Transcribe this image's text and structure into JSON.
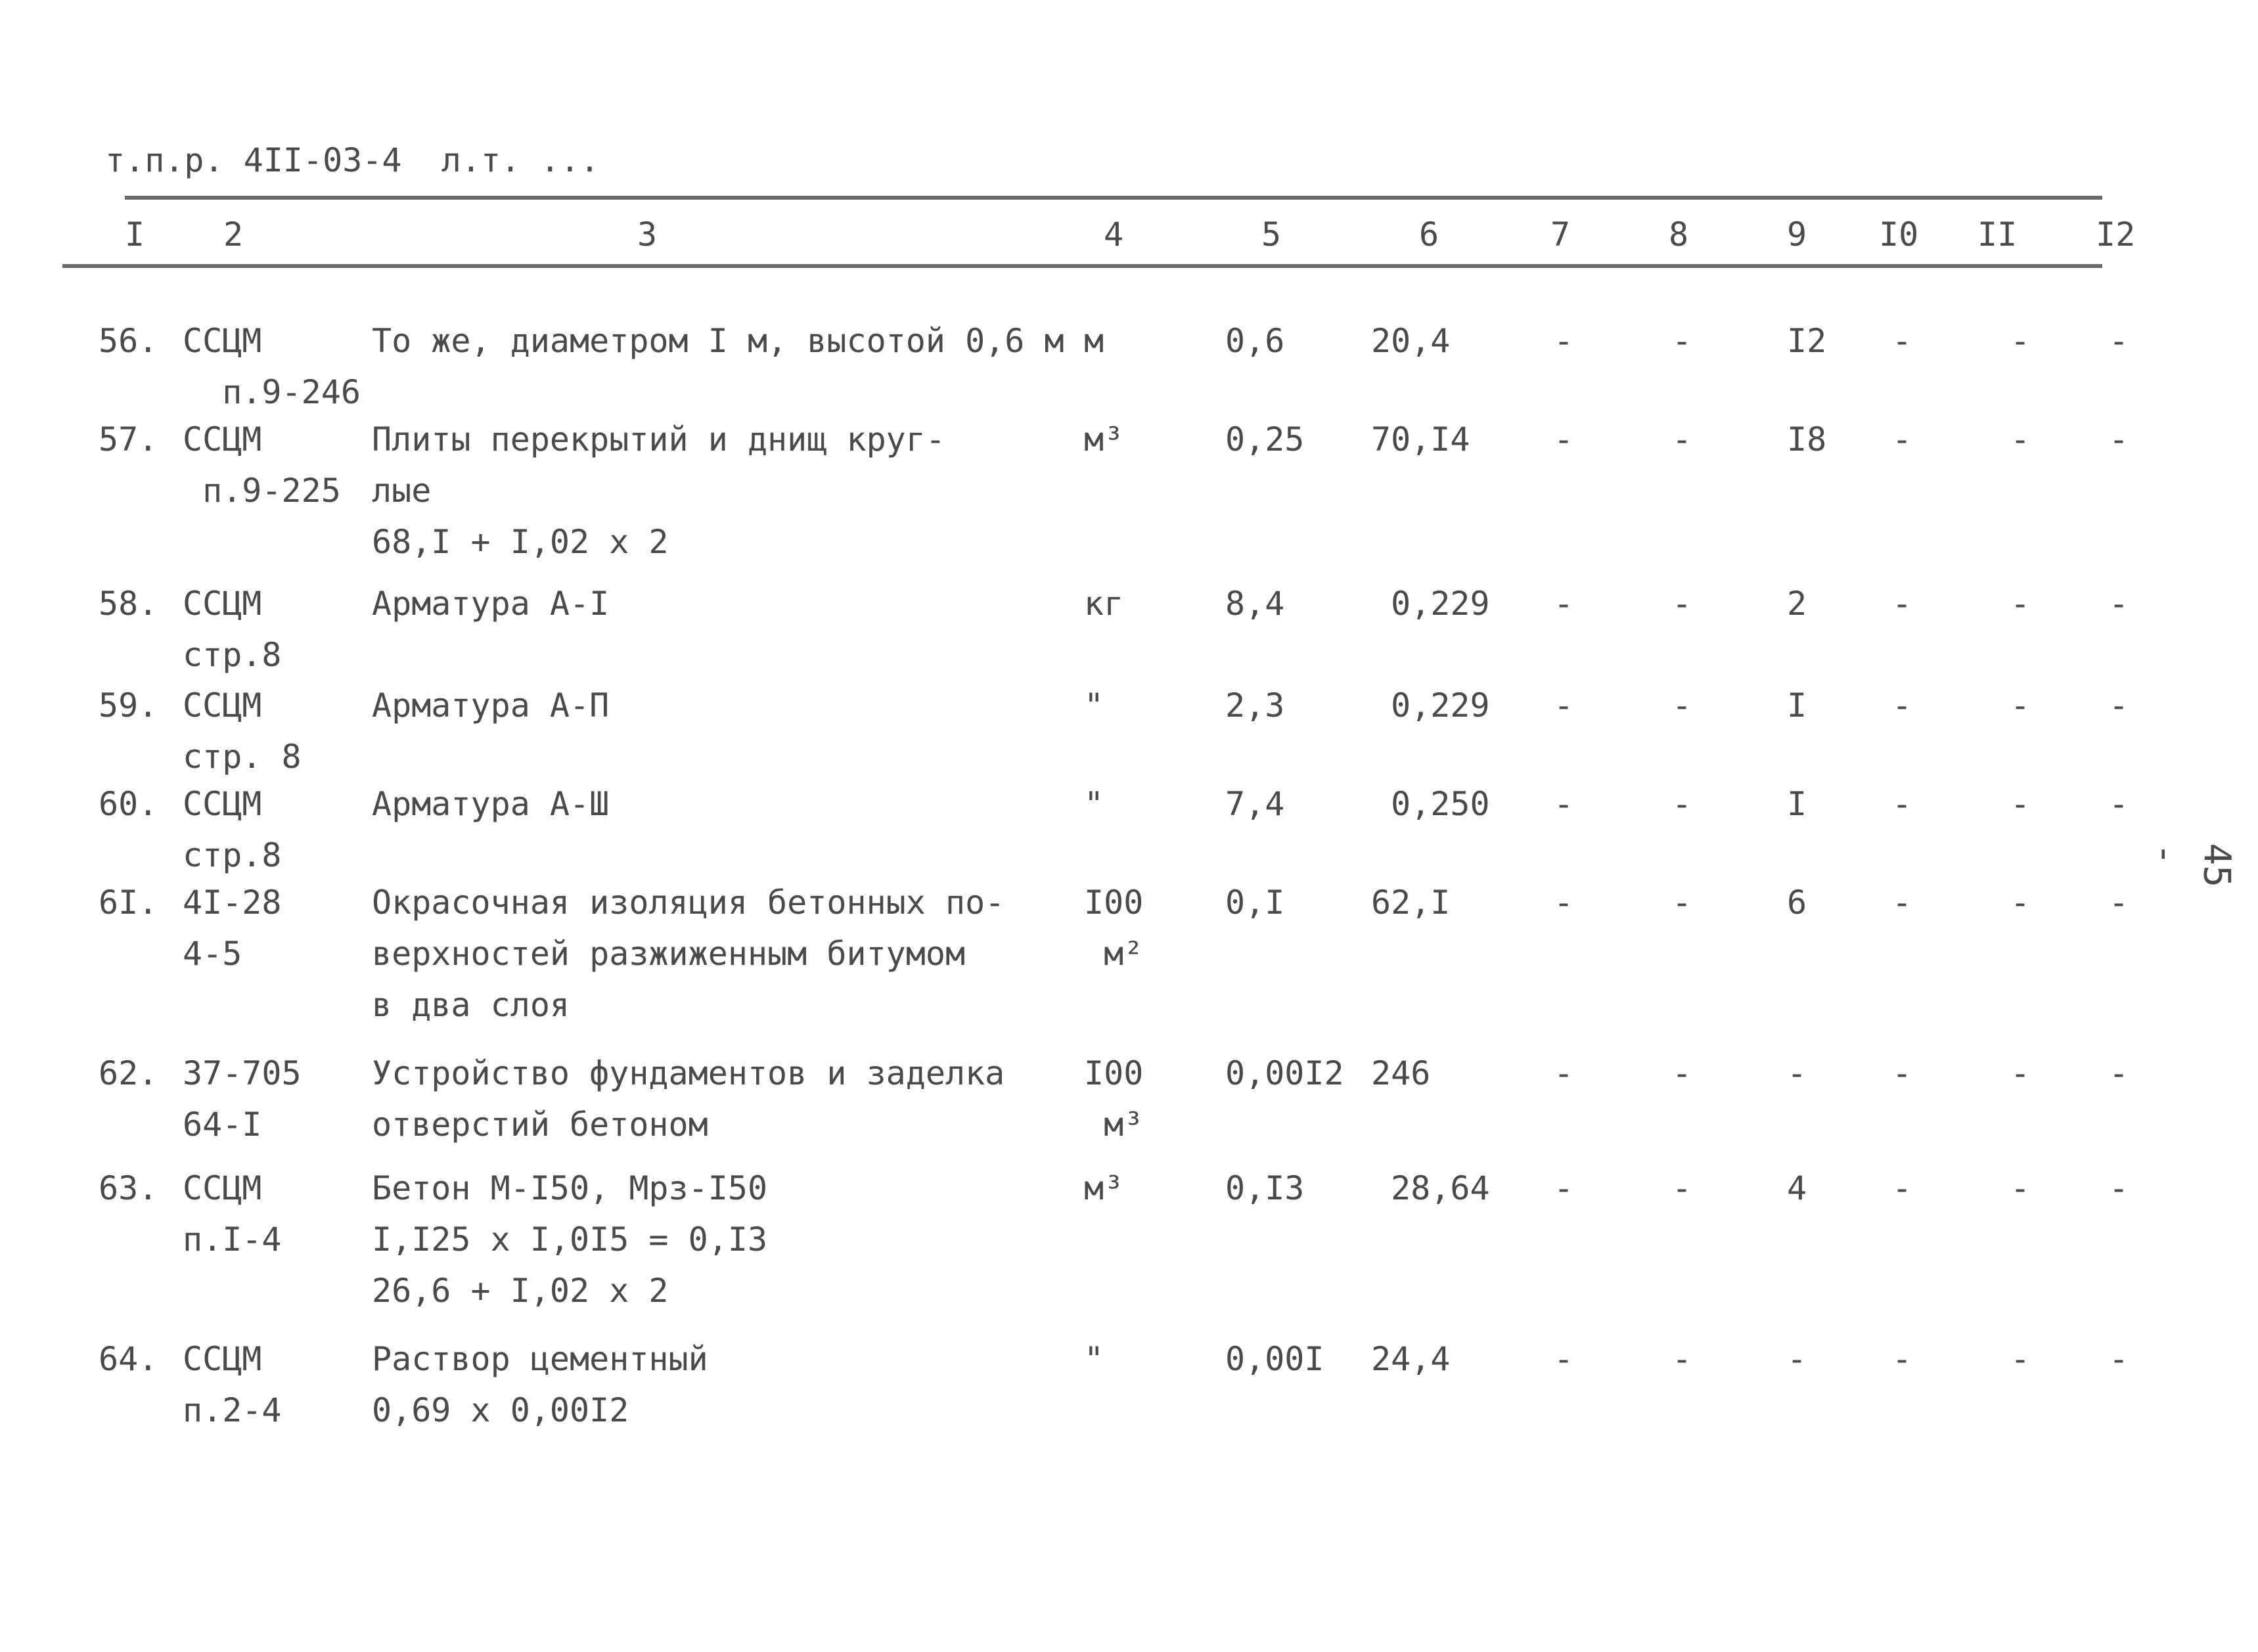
{
  "header": {
    "doc_code": "т.п.р. 4II-03-4  л.т. ..."
  },
  "columns": [
    "I",
    "2",
    "3",
    "4",
    "5",
    "6",
    "7",
    "8",
    "9",
    "I0",
    "II",
    "I2"
  ],
  "rows": [
    {
      "num": "56.",
      "code": "ССЦМ\n  п.9-246",
      "desc": "То же, диаметром I м, высотой 0,6 м",
      "unit": "м",
      "c5": "0,6",
      "c6": "20,4",
      "c7": "-",
      "c8": "-",
      "c9": "I2",
      "c10": "-",
      "c11": "-",
      "c12": "-"
    },
    {
      "num": "57.",
      "code": "ССЦМ\n п.9-225",
      "desc": "Плиты перекрытий и днищ круг-\nлые\n68,I + I,02 x 2",
      "unit": "м³",
      "c5": "0,25",
      "c6": "70,I4",
      "c7": "-",
      "c8": "-",
      "c9": "I8",
      "c10": "-",
      "c11": "-",
      "c12": "-"
    },
    {
      "num": "58.",
      "code": "ССЦМ\nстр.8",
      "desc": "Арматура А-I",
      "unit": "кг",
      "c5": "8,4",
      "c6": " 0,229",
      "c7": "-",
      "c8": "-",
      "c9": "2",
      "c10": "-",
      "c11": "-",
      "c12": "-"
    },
    {
      "num": "59.",
      "code": "ССЦМ\nстр. 8",
      "desc": "Арматура А-П",
      "unit": "\"",
      "c5": "2,3",
      "c6": " 0,229",
      "c7": "-",
      "c8": "-",
      "c9": "I",
      "c10": "-",
      "c11": "-",
      "c12": "-"
    },
    {
      "num": "60.",
      "code": "ССЦМ\nстр.8",
      "desc": "Арматура А-Ш",
      "unit": "\"",
      "c5": "7,4",
      "c6": " 0,250",
      "c7": "-",
      "c8": "-",
      "c9": "I",
      "c10": "-",
      "c11": "-",
      "c12": "-"
    },
    {
      "num": "6I.",
      "code": "4I-28\n4-5",
      "desc": "Окрасочная изоляция бетонных по-\nверхностей разжиженным битумом\nв два слоя",
      "unit": "I00\n м²",
      "c5": "0,I",
      "c6": "62,I",
      "c7": "-",
      "c8": "-",
      "c9": "6",
      "c10": "-",
      "c11": "-",
      "c12": "-"
    },
    {
      "num": "62.",
      "code": "37-705\n64-I",
      "desc": "Устройство фундаментов и заделка\nотверстий бетоном",
      "unit": "I00\n м³",
      "c5": "0,00I2",
      "c6": "246",
      "c7": "-",
      "c8": "-",
      "c9": "-",
      "c10": "-",
      "c11": "-",
      "c12": "-"
    },
    {
      "num": "63.",
      "code": "ССЦМ\nп.I-4",
      "desc": "Бетон М-I50, Мрз-I50\nI,I25 x I,0I5 = 0,I3\n26,6 + I,02 x 2",
      "unit": "м³",
      "c5": "0,I3",
      "c6": " 28,64",
      "c7": "-",
      "c8": "-",
      "c9": "4",
      "c10": "-",
      "c11": "-",
      "c12": "-"
    },
    {
      "num": "64.",
      "code": "ССЦМ\nп.2-4",
      "desc": "Раствор цементный\n0,69 x 0,00I2",
      "unit": "\"",
      "c5": "0,00I",
      "c6": "24,4",
      "c7": "-",
      "c8": "-",
      "c9": "-",
      "c10": "-",
      "c11": "-",
      "c12": "-"
    }
  ],
  "page_number": "- 45 -"
}
